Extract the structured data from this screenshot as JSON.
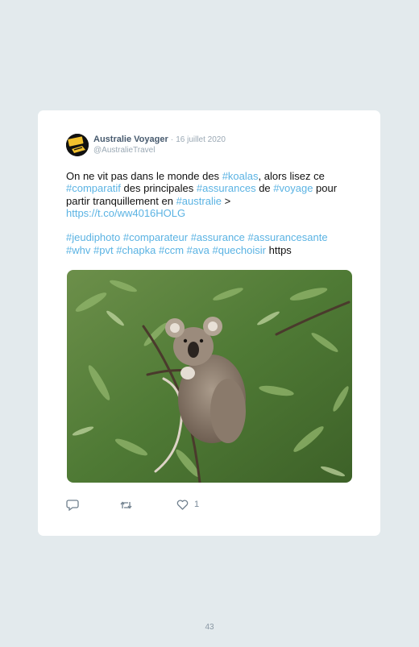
{
  "tweet": {
    "display_name": "Australie Voyager",
    "separator": "·",
    "date": "16 juillet 2020",
    "handle": "@AustralieTravel",
    "body": {
      "t1": "On ne vit pas dans le monde des ",
      "h_koalas": "#koalas",
      "t2": ", alors lisez ce ",
      "h_comparatif": "#comparatif",
      "t3": " des principales ",
      "h_assurances": "#assurances",
      "t4": " de ",
      "h_voyage": "#voyage",
      "t5": " pour partir tranquillement en ",
      "h_australie": "#australie",
      "t6": " > ",
      "link": "https://t.co/ww4016HOLG",
      "tags": [
        "#jeudiphoto",
        "#comparateur",
        "#assurance",
        "#assurancesante",
        "#whv",
        "#pvt",
        "#chapka",
        "#ccm",
        "#ava",
        "#quechoisir"
      ],
      "trailing": "https"
    },
    "image": "koala-in-eucalyptus-photo",
    "actions": {
      "reply_icon": "reply-icon",
      "retweet_icon": "retweet-icon",
      "like_icon": "heart-icon",
      "like_count": "1"
    }
  },
  "page_number": "43",
  "colors": {
    "background": "#e3eaed",
    "card": "#ffffff",
    "link": "#5bb3e3",
    "name": "#475a6e",
    "muted": "#9aa8b4"
  }
}
